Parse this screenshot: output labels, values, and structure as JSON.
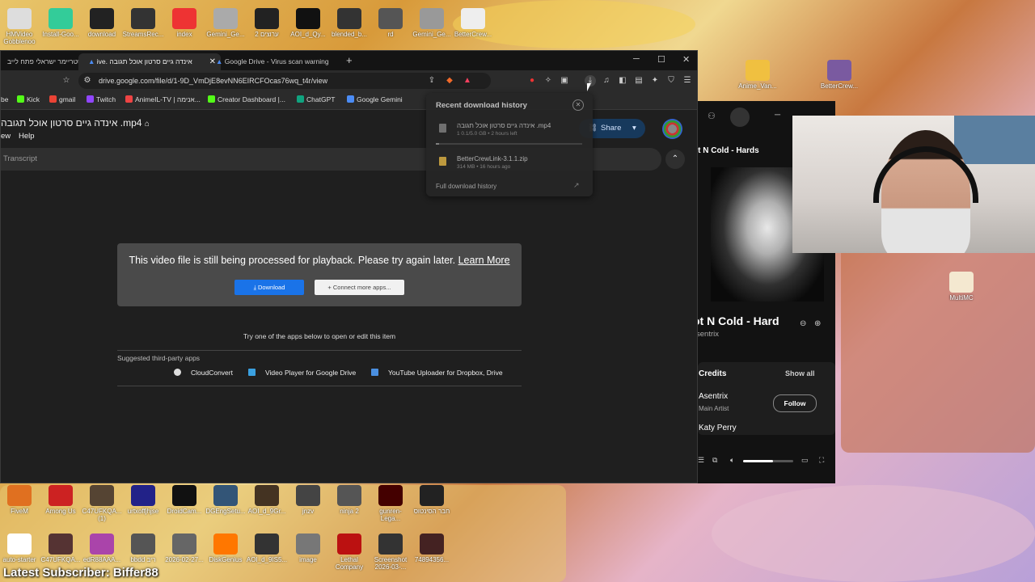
{
  "desktop": {
    "top_icons": [
      {
        "label": "HMVideo\nGobblenoo",
        "color": "#ddd"
      },
      {
        "label": "Install-Goo...",
        "color": "#3c9"
      },
      {
        "label": "download",
        "color": "#222"
      },
      {
        "label": "StreamsRec...",
        "color": "#333"
      },
      {
        "label": "index",
        "color": "#e33"
      },
      {
        "label": "Gemini_Ge...",
        "color": "#aaa"
      },
      {
        "label": "2 ערוצים",
        "color": "#222"
      },
      {
        "label": "AOI_d_Qy...",
        "color": "#111"
      },
      {
        "label": "blended_b...",
        "color": "#333"
      },
      {
        "label": "rd",
        "color": "#555"
      },
      {
        "label": "Gemini_Ge...",
        "color": "#999"
      },
      {
        "label": "BetterCrew...",
        "color": "#eee"
      }
    ],
    "right_icons": [
      {
        "label": "Anime_Van...",
        "color": "#f0c040"
      },
      {
        "label": "BetterCrew...",
        "color": "#7a5aa0"
      },
      {
        "label": "MultiMC",
        "color": "#f4e8d0"
      }
    ],
    "bottom_icons_row1": [
      {
        "label": "FiveM",
        "color": "#e07020"
      },
      {
        "label": "Among Us",
        "color": "#c22"
      },
      {
        "label": "C47UFKQA...(1)",
        "color": "#543"
      },
      {
        "label": "urtxoffjhjse",
        "color": "#228"
      },
      {
        "label": "DroidCam...",
        "color": "#111"
      },
      {
        "label": "DGEngSetu...",
        "color": "#357"
      },
      {
        "label": "AOI_d_9Gr...",
        "color": "#432"
      },
      {
        "label": "jnzv",
        "color": "#444"
      },
      {
        "label": "ninja 2",
        "color": "#555"
      },
      {
        "label": "gunren-Lega...",
        "color": "#400"
      },
      {
        "label": "חבר הסינטוס",
        "color": "#222"
      }
    ],
    "bottom_icons_row2": [
      {
        "label": "auto-starter",
        "color": "#fff"
      },
      {
        "label": "C47UFKQA...",
        "color": "#533"
      },
      {
        "label": "edR88AAA...",
        "color": "#a4a"
      },
      {
        "label": "bbdd ריב",
        "color": "#555"
      },
      {
        "label": "2026-02-27...",
        "color": "#666"
      },
      {
        "label": "DiskGenius",
        "color": "#f70"
      },
      {
        "label": "AOI_d_9IS5...",
        "color": "#333"
      },
      {
        "label": "image",
        "color": "#777"
      },
      {
        "label": "Lethal Company",
        "color": "#b11"
      },
      {
        "label": "Screenshot 2026-03-...",
        "color": "#333"
      },
      {
        "label": "74894356...",
        "color": "#422"
      }
    ],
    "subscriber_text": "Latest Subscriber: Biffer88"
  },
  "browser": {
    "tabs": [
      {
        "label": "סטריימר ישראלי פתח לייב"
      },
      {
        "label": "ive. אינדה גיים סרטון אוכל תגובה"
      },
      {
        "label": "Google Drive - Virus scan warning"
      }
    ],
    "new_tab": "+",
    "window_controls": {
      "minimize": "─",
      "maximize": "☐",
      "close": "✕"
    },
    "url": "drive.google.com/file/d/1-9D_VmDjE8evNN6EIRCFOcas76wq_t4r/view",
    "bookmarks": [
      {
        "label": "be",
        "color": "#c00"
      },
      {
        "label": "Kick",
        "color": "#53fc18"
      },
      {
        "label": "gmail",
        "color": "#ea4335"
      },
      {
        "label": "Twitch",
        "color": "#9146ff"
      },
      {
        "label": "AnimeIL-TV | אנימה...",
        "color": "#e44"
      },
      {
        "label": "Creator Dashboard |...",
        "color": "#53fc18"
      },
      {
        "label": "ChatGPT",
        "color": "#10a37f"
      },
      {
        "label": "Google Gemini",
        "color": "#4b8cf5"
      }
    ],
    "drive": {
      "file_title": "אינדה גיים סרטון אוכל תגובה .mp4",
      "menu": [
        "ew",
        "Help"
      ],
      "transcript": "Transcript",
      "share": "Share",
      "notice": "This video file is still being processed for playback. Please try again later.",
      "learn_more": "Learn More",
      "download_btn": "Download",
      "connect_btn": "Connect more apps...",
      "try_line": "Try one of the apps below to open or edit this item",
      "suggested_header": "Suggested third-party apps",
      "apps": [
        {
          "label": "CloudConvert",
          "color": "#ddd"
        },
        {
          "label": "Video Player for Google Drive",
          "color": "#3aa0e0"
        },
        {
          "label": "YouTube Uploader for Dropbox, Drive",
          "color": "#4a8fe0"
        }
      ]
    },
    "downloads": {
      "header": "Recent download history",
      "items": [
        {
          "name": "אינדה גיים סרטון אוכל תגובה .mp4",
          "status": "1 0.1/5.0 GB • 2 hours left",
          "progress": 0.02
        },
        {
          "name": "BetterCrewLink-3.1.1.zip",
          "status": "314 MB • 16 hours ago"
        }
      ],
      "full_history": "Full download history"
    }
  },
  "spotify": {
    "now_playing_header": "ot N Cold - Hards",
    "title": "ot N Cold - Hard",
    "artist": "sentrix",
    "credits_header": "Credits",
    "show_all": "Show all",
    "credits": [
      {
        "name": "Asentrix",
        "role": "Main Artist"
      },
      {
        "name": "Katy Perry",
        "role": ""
      }
    ],
    "follow": "Follow",
    "volume": 0.6
  }
}
